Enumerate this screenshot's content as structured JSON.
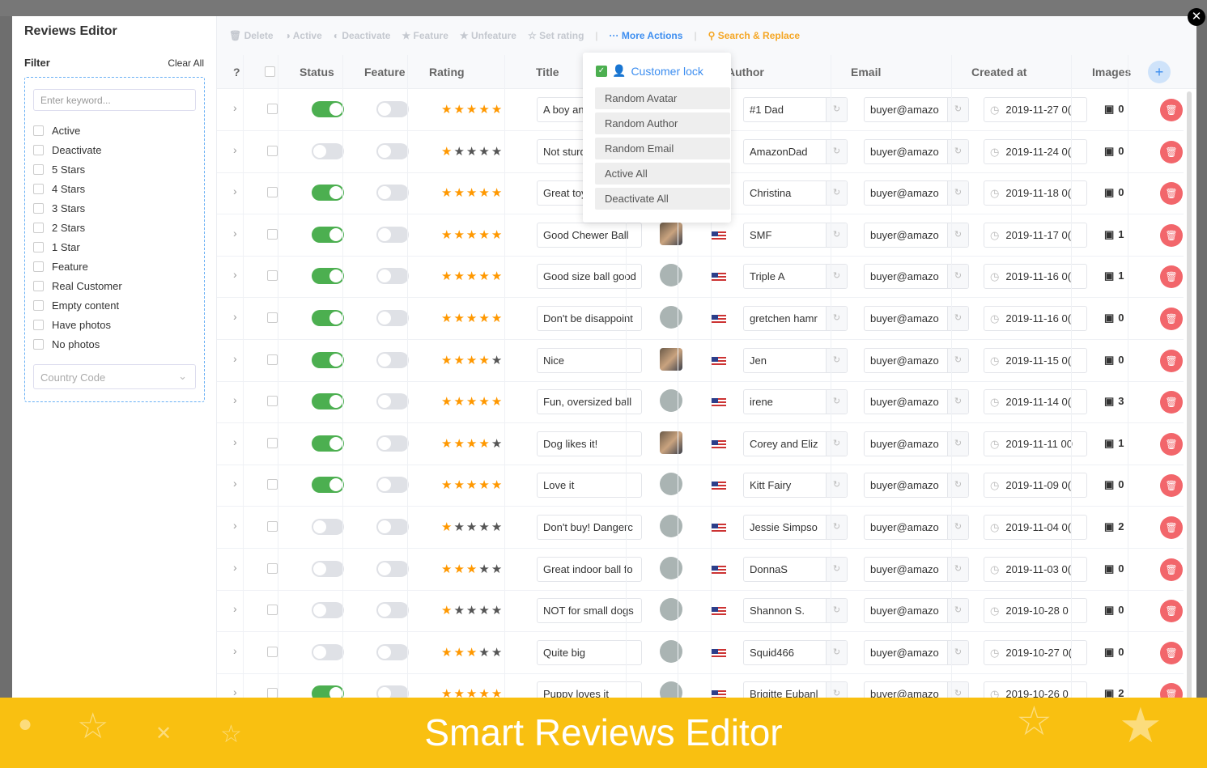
{
  "title": "Reviews Editor",
  "filter": {
    "label": "Filter",
    "clear_all": "Clear All",
    "keyword_placeholder": "Enter keyword...",
    "options": [
      "Active",
      "Deactivate",
      "5 Stars",
      "4 Stars",
      "3 Stars",
      "2 Stars",
      "1 Star",
      "Feature",
      "Real Customer",
      "Empty content",
      "Have photos",
      "No photos"
    ],
    "country_placeholder": "Country Code"
  },
  "toolbar": {
    "delete": "Delete",
    "active": "Active",
    "deactivate": "Deactivate",
    "feature": "Feature",
    "unfeature": "Unfeature",
    "set_rating": "Set rating",
    "more_actions": "More Actions",
    "search_replace": "Search & Replace"
  },
  "columns": {
    "help": "?",
    "status": "Status",
    "feature": "Feature",
    "rating": "Rating",
    "title": "Title",
    "author": "Author",
    "email": "Email",
    "created_at": "Created at",
    "images": "Images"
  },
  "more_menu": {
    "customer_lock": "Customer lock",
    "items": [
      "Random Avatar",
      "Random Author",
      "Random Email",
      "Active All",
      "Deactivate All"
    ]
  },
  "rows": [
    {
      "active": true,
      "rating": 5,
      "title": "A boy and",
      "avatar": "default",
      "author": "#1 Dad",
      "email": "buyer@amazo",
      "created": "2019-11-27 0(",
      "images": "0"
    },
    {
      "active": false,
      "rating": 1,
      "title": "Not sturdy",
      "avatar": "default",
      "author": "AmazonDad",
      "email": "buyer@amazo",
      "created": "2019-11-24 0(",
      "images": "0"
    },
    {
      "active": true,
      "rating": 5,
      "title": "Great toy",
      "avatar": "default",
      "author": "Christina",
      "email": "buyer@amazo",
      "created": "2019-11-18 0(",
      "images": "0"
    },
    {
      "active": true,
      "rating": 5,
      "title": "Good Chewer Ball",
      "avatar": "photo",
      "author": "SMF",
      "email": "buyer@amazo",
      "created": "2019-11-17 0(",
      "images": "1"
    },
    {
      "active": true,
      "rating": 5,
      "title": "Good size ball good",
      "avatar": "default",
      "author": "Triple A",
      "email": "buyer@amazo",
      "created": "2019-11-16 0(",
      "images": "1"
    },
    {
      "active": true,
      "rating": 5,
      "title": "Don't be disappoint",
      "avatar": "default",
      "author": "gretchen hamr",
      "email": "buyer@amazo",
      "created": "2019-11-16 0(",
      "images": "0"
    },
    {
      "active": true,
      "rating": 4,
      "title": "Nice",
      "avatar": "photo",
      "author": "Jen",
      "email": "buyer@amazo",
      "created": "2019-11-15 0(",
      "images": "0"
    },
    {
      "active": true,
      "rating": 5,
      "title": "Fun, oversized ball",
      "avatar": "default",
      "author": "irene",
      "email": "buyer@amazo",
      "created": "2019-11-14 0(",
      "images": "3"
    },
    {
      "active": true,
      "rating": 4,
      "title": "Dog likes it!",
      "avatar": "photo",
      "author": "Corey and Eliz",
      "email": "buyer@amazo",
      "created": "2019-11-11 00",
      "images": "1"
    },
    {
      "active": true,
      "rating": 5,
      "title": "Love it",
      "avatar": "default",
      "author": "Kitt Fairy",
      "email": "buyer@amazo",
      "created": "2019-11-09 0(",
      "images": "0"
    },
    {
      "active": false,
      "rating": 1,
      "title": "Don't buy! Dangerc",
      "avatar": "default",
      "author": "Jessie Simpso",
      "email": "buyer@amazo",
      "created": "2019-11-04 0(",
      "images": "2"
    },
    {
      "active": false,
      "rating": 3,
      "title": "Great indoor ball fo",
      "avatar": "default",
      "author": "DonnaS",
      "email": "buyer@amazo",
      "created": "2019-11-03 0(",
      "images": "0"
    },
    {
      "active": false,
      "rating": 1,
      "title": "NOT for small dogs",
      "avatar": "default",
      "author": "Shannon S.",
      "email": "buyer@amazo",
      "created": "2019-10-28 0",
      "images": "0"
    },
    {
      "active": false,
      "rating": 3,
      "title": "Quite big",
      "avatar": "default",
      "author": "Squid466",
      "email": "buyer@amazo",
      "created": "2019-10-27 0(",
      "images": "0"
    },
    {
      "active": true,
      "rating": 5,
      "title": "Puppy loves it",
      "avatar": "default",
      "author": "Brigitte Eubanl",
      "email": "buyer@amazo",
      "created": "2019-10-26 0",
      "images": "2"
    }
  ],
  "banner": "Smart Reviews Editor",
  "colors": {
    "accent": "#3d8ef0",
    "toggle_on": "#4caf50",
    "star": "#ff9800",
    "delete": "#f2666b",
    "banner": "#f9c011"
  }
}
